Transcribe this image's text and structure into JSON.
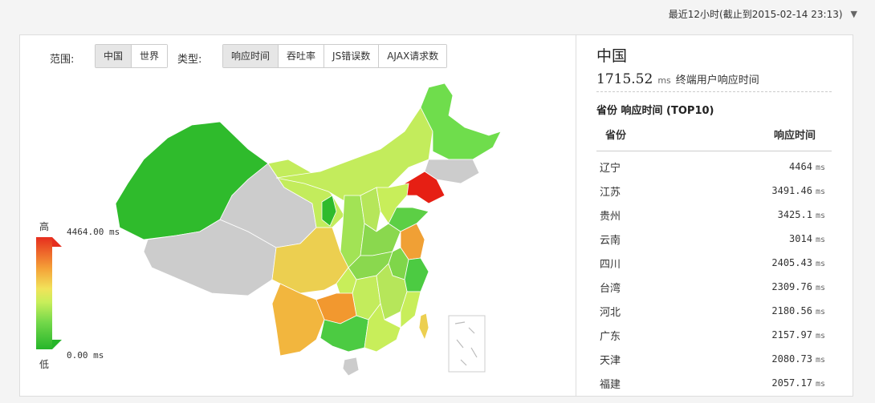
{
  "header": {
    "time_range": "最近12小时(截止到2015-02-14 23:13)"
  },
  "filters": {
    "scope_label": "范围:",
    "scope_options": [
      "中国",
      "世界"
    ],
    "scope_selected": "中国",
    "type_label": "类型:",
    "type_options": [
      "响应时间",
      "吞吐率",
      "JS错误数",
      "AJAX请求数"
    ],
    "type_selected": "响应时间"
  },
  "legend": {
    "high_label": "高",
    "low_label": "低",
    "max_value": "4464.00 ms",
    "min_value": "0.00 ms",
    "colors": {
      "high": "#e62e1e",
      "mid_high": "#f5a238",
      "mid": "#f1e35a",
      "mid_low": "#c8ee5a",
      "low": "#26b52a",
      "no_data": "#cccccc"
    }
  },
  "summary": {
    "title": "中国",
    "value": "1715.52",
    "unit": "ms",
    "description": "终端用户响应时间",
    "subtitle": "省份 响应时间 (TOP10)",
    "col_province": "省份",
    "col_response": "响应时间"
  },
  "top10": [
    {
      "province": "辽宁",
      "value": "4464",
      "unit": "ms"
    },
    {
      "province": "江苏",
      "value": "3491.46",
      "unit": "ms"
    },
    {
      "province": "贵州",
      "value": "3425.1",
      "unit": "ms"
    },
    {
      "province": "云南",
      "value": "3014",
      "unit": "ms"
    },
    {
      "province": "四川",
      "value": "2405.43",
      "unit": "ms"
    },
    {
      "province": "台湾",
      "value": "2309.76",
      "unit": "ms"
    },
    {
      "province": "河北",
      "value": "2180.56",
      "unit": "ms"
    },
    {
      "province": "广东",
      "value": "2157.97",
      "unit": "ms"
    },
    {
      "province": "天津",
      "value": "2080.73",
      "unit": "ms"
    },
    {
      "province": "福建",
      "value": "2057.17",
      "unit": "ms"
    }
  ]
}
